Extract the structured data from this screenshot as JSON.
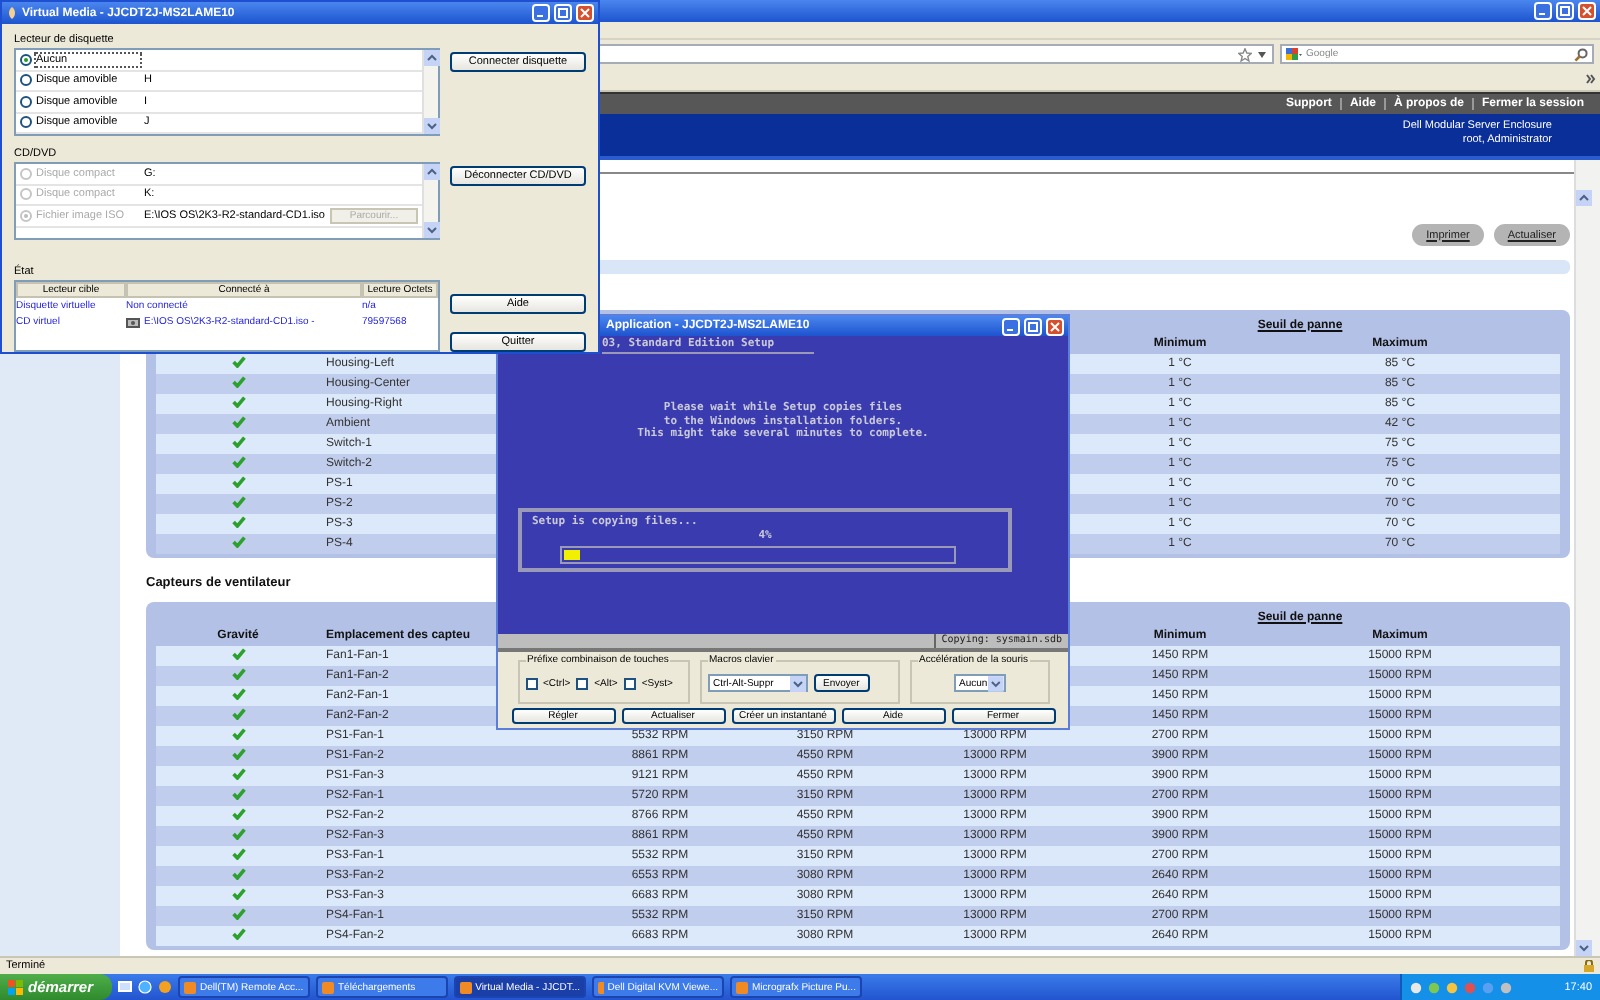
{
  "browser": {
    "search": {
      "placeholder": "Google"
    },
    "nav_links": [
      "Support",
      "Aide",
      "À propos de",
      "Fermer la session"
    ],
    "header": {
      "product": "Dell Modular Server Enclosure",
      "user": "root, Administrator"
    },
    "page_buttons": [
      "Imprimer",
      "Actualiser"
    ],
    "temperature_table": {
      "header_group": "Seuil de panne",
      "columns": {
        "minimum": "Minimum",
        "maximum": "Maximum"
      },
      "rows": [
        {
          "kind": "check",
          "name": "Housing-Left",
          "minimum": "1 °C",
          "maximum": "85 °C"
        },
        {
          "kind": "check",
          "name": "Housing-Center",
          "minimum": "1 °C",
          "maximum": "85 °C"
        },
        {
          "kind": "check",
          "name": "Housing-Right",
          "minimum": "1 °C",
          "maximum": "85 °C"
        },
        {
          "kind": "check",
          "name": "Ambient",
          "minimum": "1 °C",
          "maximum": "42 °C"
        },
        {
          "kind": "check",
          "name": "Switch-1",
          "minimum": "1 °C",
          "maximum": "75 °C"
        },
        {
          "kind": "check",
          "name": "Switch-2",
          "minimum": "1 °C",
          "maximum": "75 °C"
        },
        {
          "kind": "check",
          "name": "PS-1",
          "minimum": "1 °C",
          "maximum": "70 °C"
        },
        {
          "kind": "check",
          "name": "PS-2",
          "minimum": "1 °C",
          "maximum": "70 °C"
        },
        {
          "kind": "check",
          "name": "PS-3",
          "minimum": "1 °C",
          "maximum": "70 °C"
        },
        {
          "kind": "check",
          "name": "PS-4",
          "minimum": "1 °C",
          "maximum": "70 °C"
        }
      ]
    },
    "fan_section": {
      "title": "Capteurs de ventilateur",
      "header_group": "Seuil de panne",
      "columns": {
        "severity": "Gravité",
        "location": "Emplacement des capteu",
        "minimum": "Minimum",
        "maximum": "Maximum"
      },
      "rows": [
        {
          "kind": "check",
          "name": "Fan1-Fan-1",
          "minimum": "1450 RPM",
          "maximum": "15000 RPM"
        },
        {
          "kind": "check",
          "name": "Fan1-Fan-2",
          "minimum": "1450 RPM",
          "maximum": "15000 RPM"
        },
        {
          "kind": "check",
          "name": "Fan2-Fan-1",
          "minimum": "1450 RPM",
          "maximum": "15000 RPM"
        },
        {
          "kind": "check",
          "name": "Fan2-Fan-2",
          "minimum": "1450 RPM",
          "maximum": "15000 RPM"
        },
        {
          "kind": "check",
          "name": "PS1-Fan-1",
          "column_3": "5532 RPM",
          "column_4": "3150 RPM",
          "column_5": "13000 RPM",
          "minimum": "2700 RPM",
          "maximum": "15000 RPM"
        },
        {
          "kind": "check",
          "name": "PS1-Fan-2",
          "column_3": "8861 RPM",
          "column_4": "4550 RPM",
          "column_5": "13000 RPM",
          "minimum": "3900 RPM",
          "maximum": "15000 RPM"
        },
        {
          "kind": "check",
          "name": "PS1-Fan-3",
          "column_3": "9121 RPM",
          "column_4": "4550 RPM",
          "column_5": "13000 RPM",
          "minimum": "3900 RPM",
          "maximum": "15000 RPM"
        },
        {
          "kind": "check",
          "name": "PS2-Fan-1",
          "column_3": "5720 RPM",
          "column_4": "3150 RPM",
          "column_5": "13000 RPM",
          "minimum": "2700 RPM",
          "maximum": "15000 RPM"
        },
        {
          "kind": "check",
          "name": "PS2-Fan-2",
          "column_3": "8766 RPM",
          "column_4": "4550 RPM",
          "column_5": "13000 RPM",
          "minimum": "3900 RPM",
          "maximum": "15000 RPM"
        },
        {
          "kind": "check",
          "name": "PS2-Fan-3",
          "column_3": "8861 RPM",
          "column_4": "4550 RPM",
          "column_5": "13000 RPM",
          "minimum": "3900 RPM",
          "maximum": "15000 RPM"
        },
        {
          "kind": "check",
          "name": "PS3-Fan-1",
          "column_3": "5532 RPM",
          "column_4": "3150 RPM",
          "column_5": "13000 RPM",
          "minimum": "2700 RPM",
          "maximum": "15000 RPM"
        },
        {
          "kind": "check",
          "name": "PS3-Fan-2",
          "column_3": "6553 RPM",
          "column_4": "3080 RPM",
          "column_5": "13000 RPM",
          "minimum": "2640 RPM",
          "maximum": "15000 RPM"
        },
        {
          "kind": "check",
          "name": "PS3-Fan-3",
          "column_3": "6683 RPM",
          "column_4": "3080 RPM",
          "column_5": "13000 RPM",
          "minimum": "2640 RPM",
          "maximum": "15000 RPM"
        },
        {
          "kind": "check",
          "name": "PS4-Fan-1",
          "column_3": "5532 RPM",
          "column_4": "3150 RPM",
          "column_5": "13000 RPM",
          "minimum": "2700 RPM",
          "maximum": "15000 RPM"
        },
        {
          "kind": "check",
          "name": "PS4-Fan-2",
          "column_3": "6683 RPM",
          "column_4": "3080 RPM",
          "column_5": "13000 RPM",
          "minimum": "2640 RPM",
          "maximum": "15000 RPM"
        }
      ]
    },
    "status_bar": "Terminé"
  },
  "virtual_media": {
    "title": "Virtual Media - JJCDT2J-MS2LAME10",
    "floppy": {
      "label": "Lecteur de disquette",
      "items": [
        {
          "label": "Aucun",
          "selected": true,
          "disabled": false
        },
        {
          "label": "Disque amovible",
          "drive": "H",
          "selected": false,
          "disabled": false
        },
        {
          "label": "Disque amovible",
          "drive": "I",
          "selected": false,
          "disabled": false
        },
        {
          "label": "Disque amovible",
          "drive": "J",
          "selected": false,
          "disabled": false
        }
      ]
    },
    "connect_floppy": "Connecter disquette",
    "cd": {
      "label": "CD/DVD",
      "items": [
        {
          "label": "Disque compact",
          "drive": "G:",
          "selected": false,
          "disabled": true
        },
        {
          "label": "Disque compact",
          "drive": "K:",
          "selected": false,
          "disabled": true
        },
        {
          "label": "Fichier image ISO",
          "drive": "E:\\IOS OS\\2K3-R2-standard-CD1.iso",
          "browse": {
            "label": "Parcourir...",
            "disabled": true
          },
          "selected": true,
          "disabled": true
        }
      ]
    },
    "disconnect_cd": "Déconnecter CD/DVD",
    "status": {
      "label": "État",
      "columns": [
        "Lecteur cible",
        "Connecté à",
        "Lecture Octets"
      ],
      "rows": [
        {
          "kind": "plain",
          "target": "Disquette virtuelle",
          "connected_to": "Non connecté",
          "bytes_read": "n/a"
        },
        {
          "kind": "mounted",
          "target": "CD virtuel",
          "connected_to": "E:\\IOS OS\\2K3-R2-standard-CD1.iso -",
          "bytes_read": "79597568"
        }
      ]
    },
    "buttons": [
      "Aide",
      "Quitter"
    ]
  },
  "application": {
    "title": "Application - JJCDT2J-MS2LAME10",
    "console": {
      "heading": "03, Standard Edition Setup",
      "message": [
        "Please wait while Setup copies files",
        "to the Windows installation folders.",
        "This might take several minutes to complete."
      ],
      "progress": {
        "label": "Setup is copying files...",
        "percent": "4%",
        "level": 0.04
      },
      "status": "Copying: sysmain.sdb"
    },
    "key_prefix": {
      "label": "Préfixe combinaison de touches",
      "keys": [
        {
          "label": "<Ctrl>",
          "checked": false
        },
        {
          "label": "<Alt>",
          "checked": false
        },
        {
          "label": "<Syst>",
          "checked": false
        }
      ]
    },
    "macros": {
      "label": "Macros clavier",
      "value": "Ctrl-Alt-Suppr",
      "send": "Envoyer"
    },
    "mouse": {
      "label": "Accélération de la souris",
      "value": "Aucun"
    },
    "buttons": [
      "Régler",
      "Actualiser",
      "Créer un instantané",
      "Aide",
      "Fermer"
    ]
  },
  "taskbar": {
    "start": "démarrer",
    "tasks": [
      {
        "label": "Dell(TM) Remote Acc...",
        "selected": false
      },
      {
        "label": "Téléchargements",
        "selected": false
      },
      {
        "label": "Virtual Media - JJCDT...",
        "selected": true
      },
      {
        "label": "Dell Digital KVM Viewe...",
        "selected": false
      },
      {
        "label": "Micrografx Picture Pu...",
        "selected": false
      }
    ],
    "clock": "17:40"
  }
}
